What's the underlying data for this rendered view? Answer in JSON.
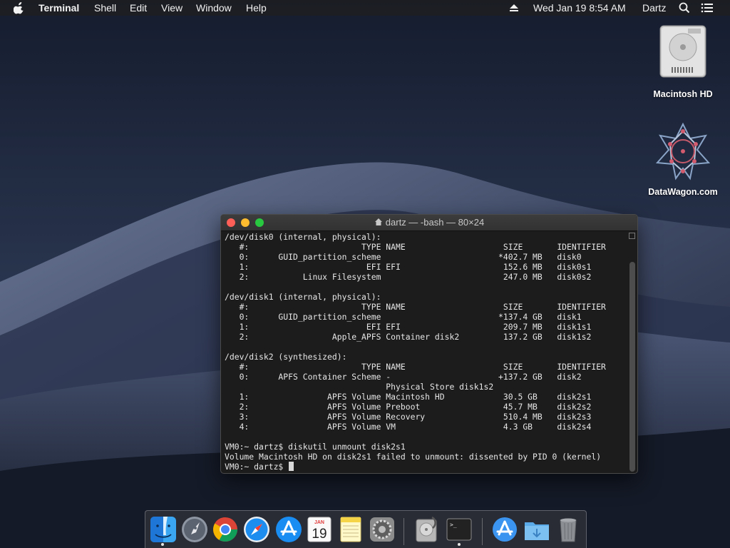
{
  "menubar": {
    "apple_icon": "apple-logo",
    "app_name": "Terminal",
    "menus": [
      "Shell",
      "Edit",
      "View",
      "Window"
    ],
    "help": "Help",
    "datetime": "Wed Jan 19  8:54 AM",
    "user": "Dartz",
    "icons": [
      "eject-icon",
      "spotlight-icon",
      "notification-center-icon"
    ]
  },
  "desktop_icons": [
    {
      "label": "Macintosh HD",
      "icon": "hard-drive-icon"
    },
    {
      "label": "DataWagon.com",
      "icon": "datawagon-logo-icon"
    }
  ],
  "terminal": {
    "title": "dartz — -bash — 80×24",
    "lines": [
      "/dev/disk0 (internal, physical):",
      "   #:                       TYPE NAME                    SIZE       IDENTIFIER",
      "   0:      GUID_partition_scheme                        *402.7 MB   disk0",
      "   1:                        EFI EFI                     152.6 MB   disk0s1",
      "   2:           Linux Filesystem                         247.0 MB   disk0s2",
      "",
      "/dev/disk1 (internal, physical):",
      "   #:                       TYPE NAME                    SIZE       IDENTIFIER",
      "   0:      GUID_partition_scheme                        *137.4 GB   disk1",
      "   1:                        EFI EFI                     209.7 MB   disk1s1",
      "   2:                 Apple_APFS Container disk2         137.2 GB   disk1s2",
      "",
      "/dev/disk2 (synthesized):",
      "   #:                       TYPE NAME                    SIZE       IDENTIFIER",
      "   0:      APFS Container Scheme -                      +137.2 GB   disk2",
      "                                 Physical Store disk1s2",
      "   1:                APFS Volume Macintosh HD            30.5 GB    disk2s1",
      "   2:                APFS Volume Preboot                 45.7 MB    disk2s2",
      "   3:                APFS Volume Recovery                510.4 MB   disk2s3",
      "   4:                APFS Volume VM                      4.3 GB     disk2s4",
      "",
      "VM0:~ dartz$ diskutil unmount disk2s1",
      "Volume Macintosh HD on disk2s1 failed to unmount: dissented by PID 0 (kernel)",
      "VM0:~ dartz$ "
    ]
  },
  "dock": {
    "apps": [
      {
        "name": "Finder",
        "icon": "finder-icon",
        "running": true
      },
      {
        "name": "Launchpad",
        "icon": "launchpad-icon",
        "running": false
      },
      {
        "name": "Google Chrome",
        "icon": "chrome-icon",
        "running": false
      },
      {
        "name": "Safari",
        "icon": "safari-icon",
        "running": false
      },
      {
        "name": "App Store",
        "icon": "app-store-icon",
        "running": false
      },
      {
        "name": "Calendar",
        "icon": "calendar-icon",
        "running": false,
        "month": "JAN",
        "day": "19"
      },
      {
        "name": "Notes",
        "icon": "notes-icon",
        "running": false
      },
      {
        "name": "System Preferences",
        "icon": "system-preferences-icon",
        "running": false
      },
      {
        "name": "Disk Utility",
        "icon": "disk-utility-icon",
        "running": false
      },
      {
        "name": "Terminal",
        "icon": "terminal-icon",
        "running": true,
        "prompt": ">_"
      },
      {
        "name": "Applications",
        "icon": "applications-folder-icon",
        "running": false
      },
      {
        "name": "Downloads",
        "icon": "downloads-folder-icon",
        "running": false
      },
      {
        "name": "Trash",
        "icon": "trash-icon",
        "running": false
      }
    ]
  },
  "colors": {
    "close": "#ff5f57",
    "minimize": "#febc2e",
    "zoom": "#28c840",
    "terminal_bg": "#1c1c1c",
    "terminal_fg": "#e6e6e6"
  }
}
